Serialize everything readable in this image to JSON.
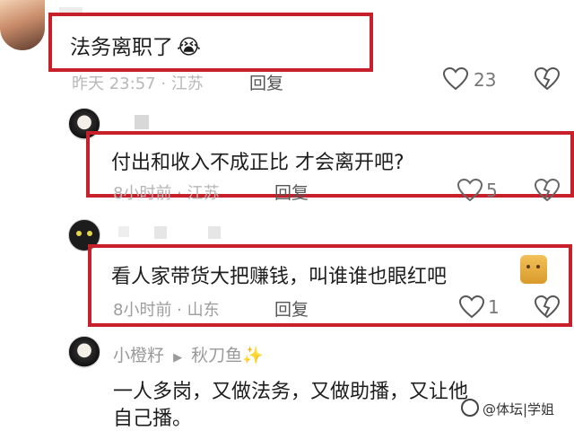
{
  "comments": [
    {
      "text": "法务离职了",
      "emoji": "😭",
      "meta": "昨天 23:57 · 江苏",
      "reply_label": "回复",
      "likes": "23"
    },
    {
      "text": "付出和收入不成正比 才会离开吧?",
      "meta": "8小时前 · 江苏",
      "reply_label": "回复",
      "likes": "5"
    },
    {
      "text": "看人家带货大把赚钱，叫谁谁也眼红吧",
      "meta": "8小时前 · 山东",
      "reply_label": "回复",
      "likes": "1"
    },
    {
      "author": "小橙籽",
      "reply_to": "秋刀鱼",
      "reply_to_emoji": "✨",
      "text_line1": "一人多岗，又做法务，又做助播，又让他",
      "text_line2": "自己播。"
    }
  ],
  "watermark": "@体坛|学姐",
  "colors": {
    "highlight": "#c8202a",
    "meta": "#9a9a9a"
  }
}
